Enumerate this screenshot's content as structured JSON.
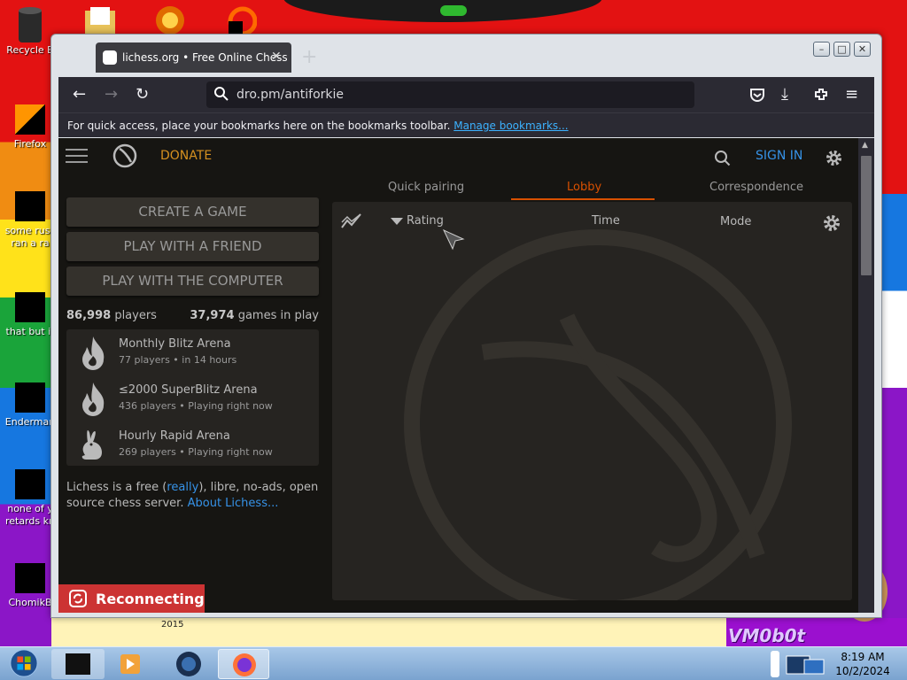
{
  "desktop": {
    "icons": [
      {
        "label": "Recycle B"
      },
      {
        "label": "Firefox"
      },
      {
        "label": "some russ ran a ra"
      },
      {
        "label": "that but it"
      },
      {
        "label": "Enderman"
      },
      {
        "label": "none of y retards kn"
      },
      {
        "label": "ChomikB"
      }
    ],
    "wallpaper_text": "VM0b0t",
    "wallpaper_year": "2015"
  },
  "browser": {
    "tab_title": "lichess.org • Free Online Chess",
    "url": "dro.pm/antiforkie",
    "bookmarks_hint": "For quick access, place your bookmarks here on the bookmarks toolbar.",
    "bookmarks_link": "Manage bookmarks..."
  },
  "site": {
    "donate": "DONATE",
    "sign_in": "SIGN IN",
    "lobby_tabs": [
      "Quick pairing",
      "Lobby",
      "Correspondence"
    ],
    "active_tab": "Lobby",
    "buttons": [
      "CREATE A GAME",
      "PLAY WITH A FRIEND",
      "PLAY WITH THE COMPUTER"
    ],
    "players_count": "86,998",
    "players_label": "players",
    "games_count": "37,974",
    "games_label": "games in play",
    "tournaments": [
      {
        "name": "Monthly Blitz Arena",
        "players": "77 players",
        "time": "in 14 hours",
        "icon": "flame-icon"
      },
      {
        "name": "≤2000 SuperBlitz Arena",
        "players": "436 players",
        "time": "Playing right now",
        "icon": "flame-icon"
      },
      {
        "name": "Hourly Rapid Arena",
        "players": "269 players",
        "time": "Playing right now",
        "icon": "rabbit-icon"
      }
    ],
    "about_pre": "Lichess is a free (",
    "about_really": "really",
    "about_mid": "), libre, no-ads, open source chess server.",
    "about_link": "About Lichess...",
    "lobby_columns": {
      "rating": "Rating",
      "time": "Time",
      "mode": "Mode"
    },
    "reconnecting": "Reconnecting"
  },
  "taskbar": {
    "time": "8:19 AM",
    "date": "10/2/2024"
  },
  "colors": {
    "accent_orange": "#d85000",
    "link_blue": "#3692e7",
    "reconnect_red": "#cc3333",
    "page_bg": "#161512"
  }
}
